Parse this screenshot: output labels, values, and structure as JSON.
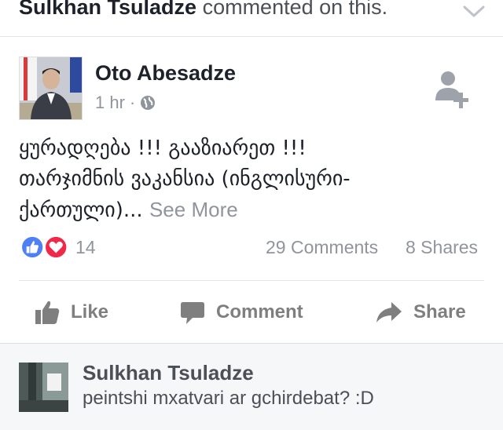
{
  "activity": {
    "actor": "Sulkhan Tsuladze",
    "action_text": "commented on this."
  },
  "post": {
    "author": "Oto Abesadze",
    "time": "1 hr",
    "separator": "·",
    "privacy_icon": "globe-icon",
    "text_line1": "ყურადღება !!! გააზიარეთ !!!",
    "text_line2": "თარჯიმნის ვაკანსია (ინგლისური-",
    "text_line3": "ქართული)...",
    "see_more": "See More"
  },
  "stats": {
    "reactions_count": "14",
    "comments": "29 Comments",
    "shares": "8 Shares"
  },
  "actions": {
    "like": "Like",
    "comment": "Comment",
    "share": "Share"
  },
  "comment": {
    "author": "Sulkhan Tsuladze",
    "text": "peintshi mxatvari ar gchirdebat? :D"
  },
  "colors": {
    "like_blue": "#4f81f5",
    "love_red": "#f0284a",
    "muted_text": "#90949c"
  }
}
